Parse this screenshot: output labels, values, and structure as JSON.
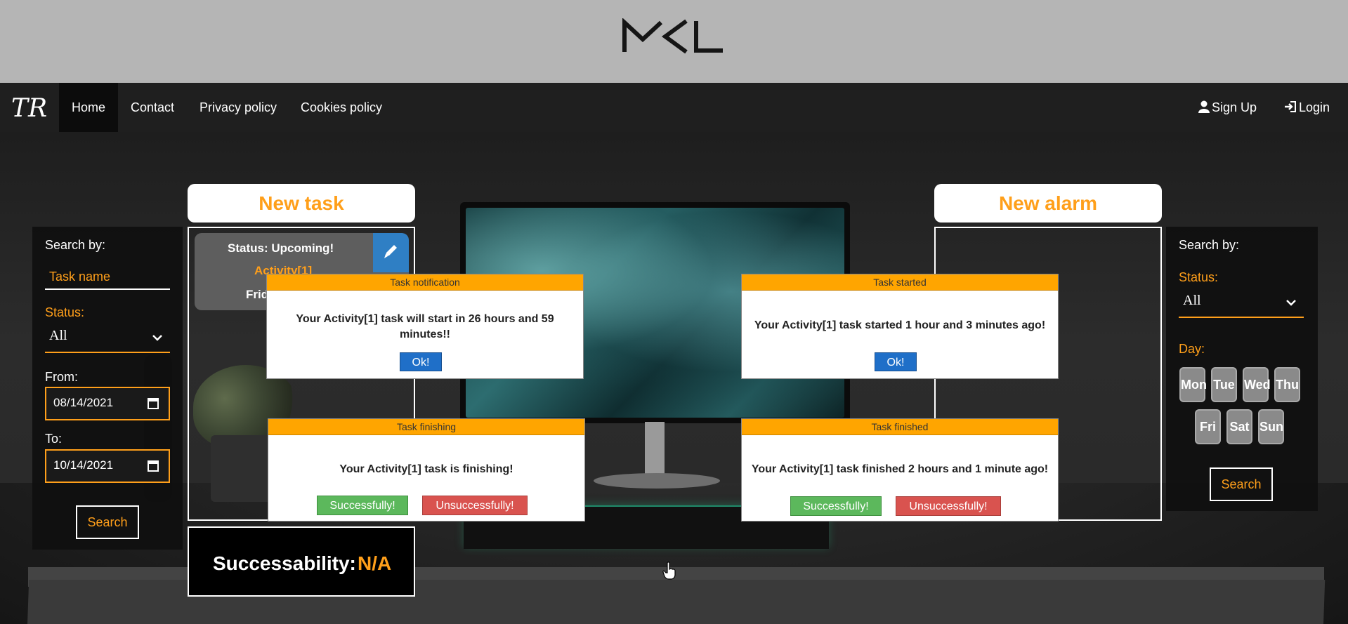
{
  "nav": {
    "items": [
      "Home",
      "Contact",
      "Privacy policy",
      "Cookies policy"
    ],
    "sign_up": "Sign Up",
    "login": "Login"
  },
  "left_search": {
    "heading": "Search by:",
    "task_name_placeholder": "Task name",
    "status_label": "Status:",
    "status_value": "All",
    "from_label": "From:",
    "from_value": "08/14/2021",
    "to_label": "To:",
    "to_value": "10/14/2021",
    "search_button": "Search"
  },
  "new_task": {
    "header": "New task",
    "card": {
      "status": "Status:   Upcoming!",
      "activity": "Activity[1]",
      "date": "Frid"
    },
    "successability_label": "Successability:",
    "successability_value": "N/A"
  },
  "new_alarm": {
    "header": "New alarm"
  },
  "right_search": {
    "heading": "Search by:",
    "status_label": "Status:",
    "status_value": "All",
    "day_label": "Day:",
    "days": [
      "Mon",
      "Tue",
      "Wed",
      "Thu",
      "Fri",
      "Sat",
      "Sun"
    ],
    "search_button": "Search"
  },
  "dialogs": {
    "notification": {
      "title": "Task notification",
      "message_line1": "Your Activity[1] task will start in 26 hours and 59",
      "message_line2": "minutes!!",
      "ok": "Ok!"
    },
    "started": {
      "title": "Task started",
      "message": "Your Activity[1] task started 1 hour and 3 minutes ago!",
      "ok": "Ok!"
    },
    "finishing": {
      "title": "Task finishing",
      "message": "Your Activity[1] task is finishing!",
      "success": "Successfully!",
      "fail": "Unsuccessfully!"
    },
    "finished": {
      "title": "Task finished",
      "message": "Your Activity[1] task finished 2 hours and 1 minute ago!",
      "success": "Successfully!",
      "fail": "Unsuccessfully!"
    }
  },
  "colors": {
    "accent": "#ff9f1a",
    "dialog_title": "#ffa500",
    "ok_button": "#1f6fc8",
    "success_button": "#5cb85c",
    "fail_button": "#d9534f"
  }
}
